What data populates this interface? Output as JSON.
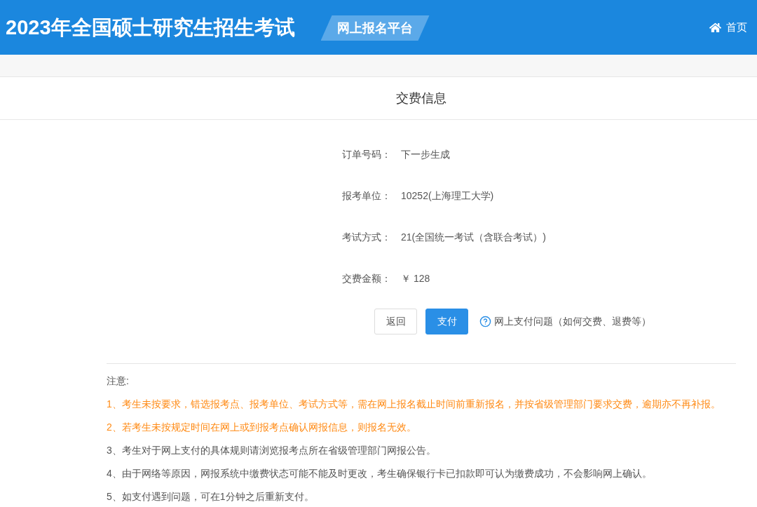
{
  "header": {
    "title": "2023年全国硕士研究生招生考试",
    "badge": "网上报名平台",
    "home_link": "首页"
  },
  "section_title": "交费信息",
  "fields": [
    {
      "label": "订单号码：",
      "value": "下一步生成"
    },
    {
      "label": "报考单位：",
      "value": "10252(上海理工大学)"
    },
    {
      "label": "考试方式：",
      "value": "21(全国统一考试（含联合考试）)"
    },
    {
      "label": "交费金额：",
      "value": "￥ 128"
    }
  ],
  "buttons": [
    {
      "label": "返回",
      "kind": "secondary"
    },
    {
      "label": "支付",
      "kind": "primary"
    }
  ],
  "help_link": "网上支付问题（如何交费、退费等）",
  "notes": {
    "heading": "注意:",
    "items": [
      {
        "text": "1、考生未按要求，错选报考点、报考单位、考试方式等，需在网上报名截止时间前重新报名，并按省级管理部门要求交费，逾期亦不再补报。",
        "kind": "warning"
      },
      {
        "text": "2、若考生未按规定时间在网上或到报考点确认网报信息，则报名无效。",
        "kind": "warning"
      },
      {
        "text": "3、考生对于网上支付的具体规则请浏览报考点所在省级管理部门网报公告。",
        "kind": "plain"
      },
      {
        "text": "4、由于网络等原因，网报系统中缴费状态可能不能及时更改，考生确保银行卡已扣款即可认为缴费成功，不会影响网上确认。",
        "kind": "plain"
      },
      {
        "text": "5、如支付遇到问题，可在1分钟之后重新支付。",
        "kind": "plain"
      }
    ]
  }
}
